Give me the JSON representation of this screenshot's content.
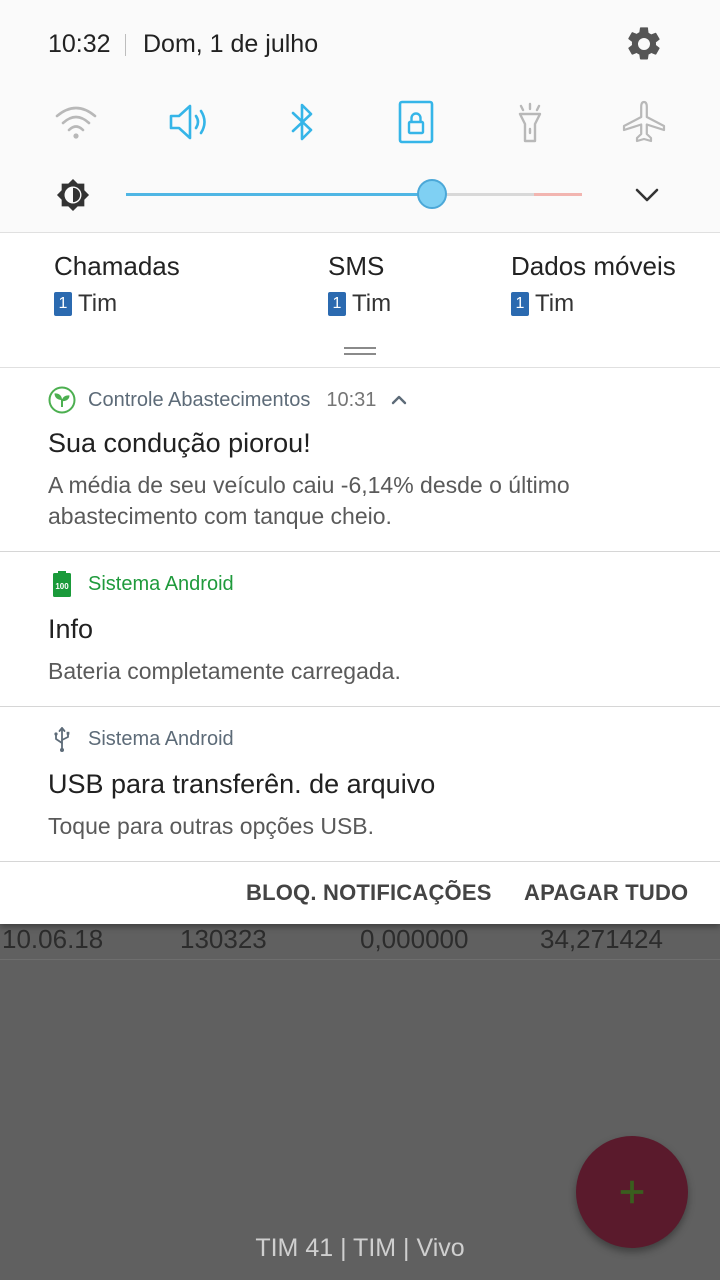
{
  "status_bar": {
    "time": "10:32",
    "date": "Dom, 1 de julho",
    "settings_icon": "gear-icon"
  },
  "quick_settings": {
    "toggles": [
      {
        "name": "wifi",
        "icon": "wifi-icon",
        "active": false
      },
      {
        "name": "sound",
        "icon": "volume-icon",
        "active": true
      },
      {
        "name": "bluetooth",
        "icon": "bluetooth-icon",
        "active": true
      },
      {
        "name": "screen-lock",
        "icon": "lock-rotation-icon",
        "active": true
      },
      {
        "name": "flashlight",
        "icon": "flashlight-icon",
        "active": false
      },
      {
        "name": "airplane",
        "icon": "airplane-icon",
        "active": false
      }
    ],
    "brightness_level": 0.67,
    "colors": {
      "active": "#35b5e8",
      "inactive": "#b8b8b8"
    }
  },
  "sim_cards": [
    {
      "label": "Chamadas",
      "sim_number": "1",
      "carrier": "Tim"
    },
    {
      "label": "SMS",
      "sim_number": "1",
      "carrier": "Tim"
    },
    {
      "label": "Dados móveis",
      "sim_number": "1",
      "carrier": "Tim"
    }
  ],
  "notifications": [
    {
      "app": "Controle Abastecimentos",
      "app_color": "#5d6b78",
      "time": "10:31",
      "title": "Sua condução piorou!",
      "text": "A média de seu veículo caiu -6,14% desde o último abastecimento com tanque cheio.",
      "icon": "leaf-icon"
    },
    {
      "app": "Sistema Android",
      "app_color": "#1f9a3c",
      "title": "Info",
      "text": "Bateria completamente carregada.",
      "icon": "battery-full-icon",
      "icon_label": "100"
    },
    {
      "app": "Sistema Android",
      "app_color": "#5d6b78",
      "title": "USB para transferên. de arquivo",
      "text": "Toque para outras opções USB.",
      "icon": "usb-icon"
    }
  ],
  "actions": {
    "block": "BLOQ. NOTIFICAÇÕES",
    "clear": "APAGAR TUDO"
  },
  "background_app": {
    "row": [
      "10.06.18",
      "130323",
      "0,000000",
      "34,271424"
    ],
    "fab_icon": "plus-icon",
    "footer": "TIM 41 | TIM | Vivo"
  }
}
